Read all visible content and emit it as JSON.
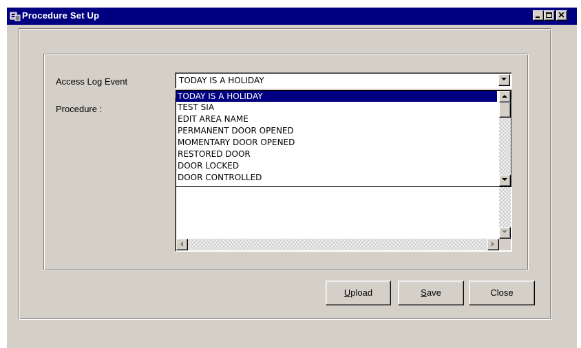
{
  "window": {
    "title": "Procedure Set Up",
    "app_icon": "procedure-setup-icon",
    "controls": {
      "minimize_icon": "minimize-icon",
      "maximize_icon": "maximize-icon",
      "close_icon": "close-icon"
    }
  },
  "form": {
    "event_label": "Access Log Event",
    "procedure_label": "Procedure :",
    "event_select": {
      "value": "TODAY IS A HOLIDAY",
      "open": true,
      "options": [
        "TODAY IS A HOLIDAY",
        "TEST SIA",
        "EDIT AREA NAME",
        "PERMANENT DOOR OPENED",
        "MOMENTARY DOOR OPENED",
        "RESTORED DOOR",
        "DOOR LOCKED",
        "DOOR CONTROLLED"
      ],
      "selected_index": 0
    },
    "procedure_text": ""
  },
  "buttons": {
    "upload": {
      "mnemonic": "U",
      "rest": "pload"
    },
    "save": {
      "mnemonic": "S",
      "rest": "ave"
    },
    "close": {
      "label": "Close"
    }
  },
  "colors": {
    "titlebar": "#000080",
    "face": "#d4d0c8",
    "selection": "#000080"
  }
}
